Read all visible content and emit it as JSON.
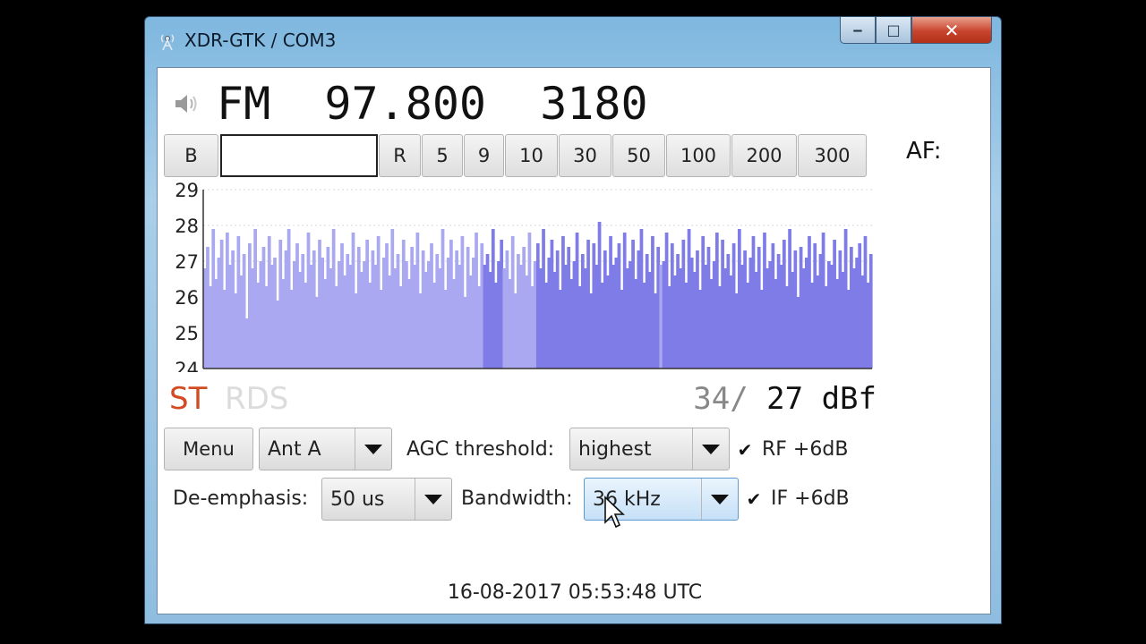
{
  "window": {
    "title": "XDR-GTK / COM3",
    "controls": {
      "minimize": "‒",
      "maximize": "□",
      "close": "✕"
    }
  },
  "tuner": {
    "mode": "FM",
    "frequency": "97.800",
    "pi": "3180",
    "display": "FM  97.800  3180",
    "af_label": "AF:"
  },
  "step_buttons": [
    {
      "label": "B"
    },
    {
      "label": "R"
    },
    {
      "label": "5"
    },
    {
      "label": "9"
    },
    {
      "label": "10"
    },
    {
      "label": "30"
    },
    {
      "label": "50"
    },
    {
      "label": "100"
    },
    {
      "label": "200"
    },
    {
      "label": "300"
    }
  ],
  "chart_data": {
    "type": "bar",
    "ylim": [
      24,
      29
    ],
    "yticks": [
      "29",
      "28",
      "27",
      "26",
      "25",
      "24"
    ],
    "y_values": [
      29,
      28,
      27,
      26,
      25,
      24
    ],
    "grid": true,
    "series_colors": {
      "light": "#aaa8f0",
      "dark": "#7f7ce8"
    },
    "dark_segments": [
      [
        0.415,
        0.445
      ],
      [
        0.495,
        0.68
      ],
      [
        0.685,
        1.0
      ]
    ],
    "values": [
      26.8,
      27.4,
      26.3,
      27.9,
      26.5,
      27.1,
      27.6,
      26.2,
      27.8,
      26.9,
      27.3,
      26.1,
      27.7,
      26.6,
      27.2,
      25.4,
      27.5,
      26.8,
      27.9,
      26.4,
      27.0,
      27.4,
      26.3,
      27.7,
      26.9,
      27.1,
      25.9,
      27.6,
      26.5,
      27.3,
      27.9,
      26.2,
      27.0,
      27.5,
      26.7,
      27.2,
      26.4,
      27.8,
      26.9,
      27.3,
      26.0,
      27.6,
      27.1,
      26.5,
      27.4,
      26.8,
      27.9,
      26.3,
      27.0,
      27.5,
      26.6,
      27.2,
      26.9,
      27.8,
      26.1,
      27.4,
      26.7,
      27.0,
      27.6,
      26.4,
      27.3,
      26.9,
      27.7,
      26.2,
      27.1,
      27.5,
      26.6,
      27.9,
      26.8,
      27.2,
      26.3,
      27.6,
      27.0,
      26.5,
      27.4,
      26.9,
      27.8,
      26.1,
      27.3,
      26.7,
      27.0,
      27.5,
      26.4,
      27.2,
      26.8,
      27.9,
      26.2,
      27.1,
      27.6,
      26.5,
      27.3,
      26.9,
      27.7,
      26.0,
      27.4,
      26.6,
      27.1,
      27.8,
      26.3,
      27.5,
      26.9,
      27.2,
      26.7,
      27.9,
      26.4,
      27.0,
      27.6,
      26.8,
      27.3,
      26.5,
      27.7,
      26.1,
      27.2,
      26.9,
      27.4,
      26.6,
      27.8,
      26.3,
      27.0,
      27.5,
      26.8,
      27.9,
      26.4,
      27.1,
      27.6,
      26.7,
      27.3,
      26.2,
      27.7,
      26.9,
      27.4,
      26.5,
      27.0,
      27.8,
      26.3,
      27.2,
      26.8,
      27.6,
      26.1,
      27.5,
      26.9,
      28.1,
      26.4,
      27.3,
      26.6,
      27.7,
      26.9,
      27.1,
      27.5,
      26.2,
      27.8,
      26.8,
      27.0,
      27.6,
      26.5,
      27.3,
      27.9,
      26.4,
      27.2,
      26.7,
      27.7,
      26.1,
      27.4,
      26.9,
      27.0,
      27.8,
      26.3,
      27.5,
      26.6,
      27.2,
      26.8,
      27.6,
      26.4,
      27.9,
      27.1,
      26.7,
      27.3,
      26.2,
      27.7,
      26.9,
      27.4,
      26.5,
      27.0,
      27.8,
      26.3,
      27.6,
      26.8,
      27.2,
      26.6,
      27.5,
      26.1,
      27.9,
      26.9,
      27.3,
      26.4,
      27.1,
      27.7,
      26.7,
      27.4,
      26.2,
      27.8,
      26.8,
      27.0,
      27.5,
      26.5,
      27.2,
      26.9,
      27.6,
      26.3,
      27.9,
      26.7,
      27.3,
      26.0,
      27.4,
      26.8,
      27.1,
      27.7,
      26.4,
      27.5,
      26.6,
      27.2,
      27.8,
      26.3,
      27.0,
      26.9,
      27.6,
      26.5,
      27.3,
      26.7,
      27.9,
      26.2,
      27.4,
      26.8,
      27.1,
      27.5,
      26.6,
      27.7,
      26.4,
      27.2
    ]
  },
  "status": {
    "st": "ST",
    "rds": "RDS",
    "signal_prefix": "34/",
    "signal_value": " 27 dBf"
  },
  "controls": {
    "menu_label": "Menu",
    "antenna": "Ant A",
    "agc_label": "AGC threshold:",
    "agc_value": "highest",
    "rf_label": "RF +6dB",
    "rf_checked": "✔",
    "deemph_label": "De-emphasis:",
    "deemph_value": "50 us",
    "bandwidth_label": "Bandwidth:",
    "bandwidth_value": "36 kHz",
    "if_label": "IF +6dB",
    "if_checked": "✔"
  },
  "footer": {
    "datetime": "16-08-2017 05:53:48 UTC"
  }
}
